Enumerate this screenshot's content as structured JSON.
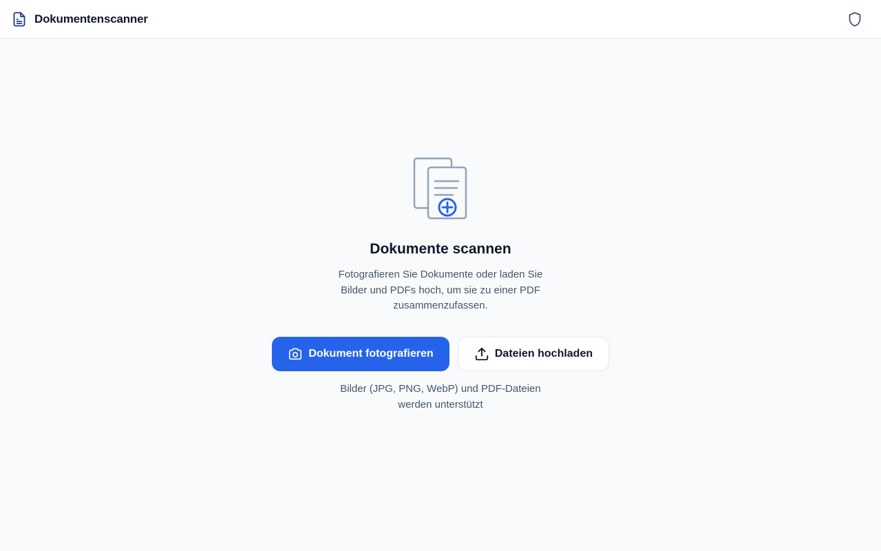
{
  "header": {
    "app_title": "Dokumentenscanner",
    "app_icon": "document-icon",
    "privacy_icon": "shield-icon"
  },
  "main": {
    "hero_icon": "documents-add-icon",
    "title": "Dokumente scannen",
    "description": "Fotografieren Sie Dokumente oder laden Sie Bilder und PDFs hoch, um sie zu einer PDF zusammenzufassen.",
    "photo_button_label": "Dokument fotografieren",
    "photo_button_icon": "camera-icon",
    "upload_button_label": "Dateien hochladen",
    "upload_button_icon": "upload-icon",
    "support_note": "Bilder (JPG, PNG, WebP) und PDF-Dateien werden unterstützt"
  },
  "colors": {
    "accent": "#2563eb",
    "background": "#f8fafc",
    "text": "#0f172a",
    "muted_text": "#475569",
    "icon_gray": "#94a3b8"
  }
}
